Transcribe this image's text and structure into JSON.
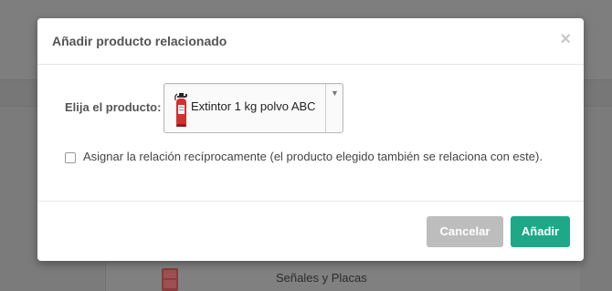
{
  "background": {
    "row_label": "Señales y Placas"
  },
  "modal": {
    "title": "Añadir producto relacionado",
    "close_symbol": "×",
    "field_label": "Elija el producto:",
    "selected_product": "Extintor 1 kg polvo ABC",
    "dropdown_arrow": "▼",
    "checkbox_label": "Asignar la relación recíprocamente (el producto elegido también se relaciona con este).",
    "checkbox_checked": false,
    "cancel_label": "Cancelar",
    "add_label": "Añadir"
  },
  "colors": {
    "primary": "#1fa887",
    "disabled": "#bdbdbd",
    "extinguisher": "#d32f2f"
  }
}
